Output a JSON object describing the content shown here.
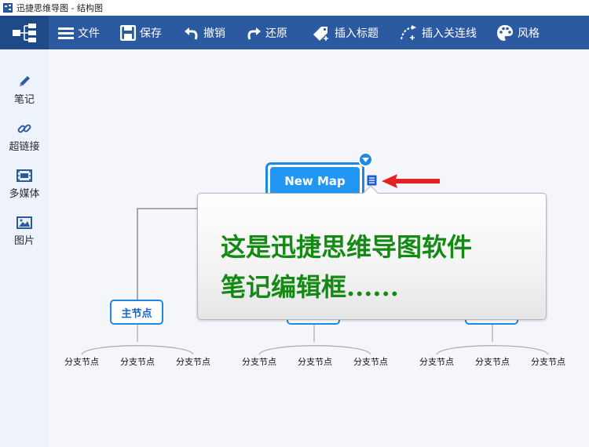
{
  "window": {
    "title": "迅捷思维导图 - 结构图"
  },
  "toolbar": {
    "file": "文件",
    "save": "保存",
    "undo": "撤销",
    "redo": "还原",
    "insert_title": "插入标题",
    "insert_relation": "插入关连线",
    "style": "风格"
  },
  "sidebar": {
    "items": [
      {
        "label": "笔记",
        "icon": "pencil-icon"
      },
      {
        "label": "超链接",
        "icon": "link-icon"
      },
      {
        "label": "多媒体",
        "icon": "film-icon"
      },
      {
        "label": "图片",
        "icon": "image-icon"
      }
    ]
  },
  "map": {
    "center_node": "New Map",
    "main_node": "主节点",
    "groups": [
      {
        "subs": [
          "分支节点",
          "分支节点",
          "分支节点"
        ]
      },
      {
        "subs": [
          "分支节点",
          "分支节点",
          "分支节点"
        ]
      },
      {
        "subs": [
          "分支节点",
          "分支节点",
          "分支节点"
        ]
      }
    ]
  },
  "note_popup": {
    "text": "这是迅捷思维导图软件\n笔记编辑框......"
  },
  "colors": {
    "toolbar": "#2b5aa0",
    "node_border": "#1e88e5",
    "node_fill": "#2196f3",
    "note_text": "#148a14",
    "annotation_arrow": "#e52222"
  }
}
